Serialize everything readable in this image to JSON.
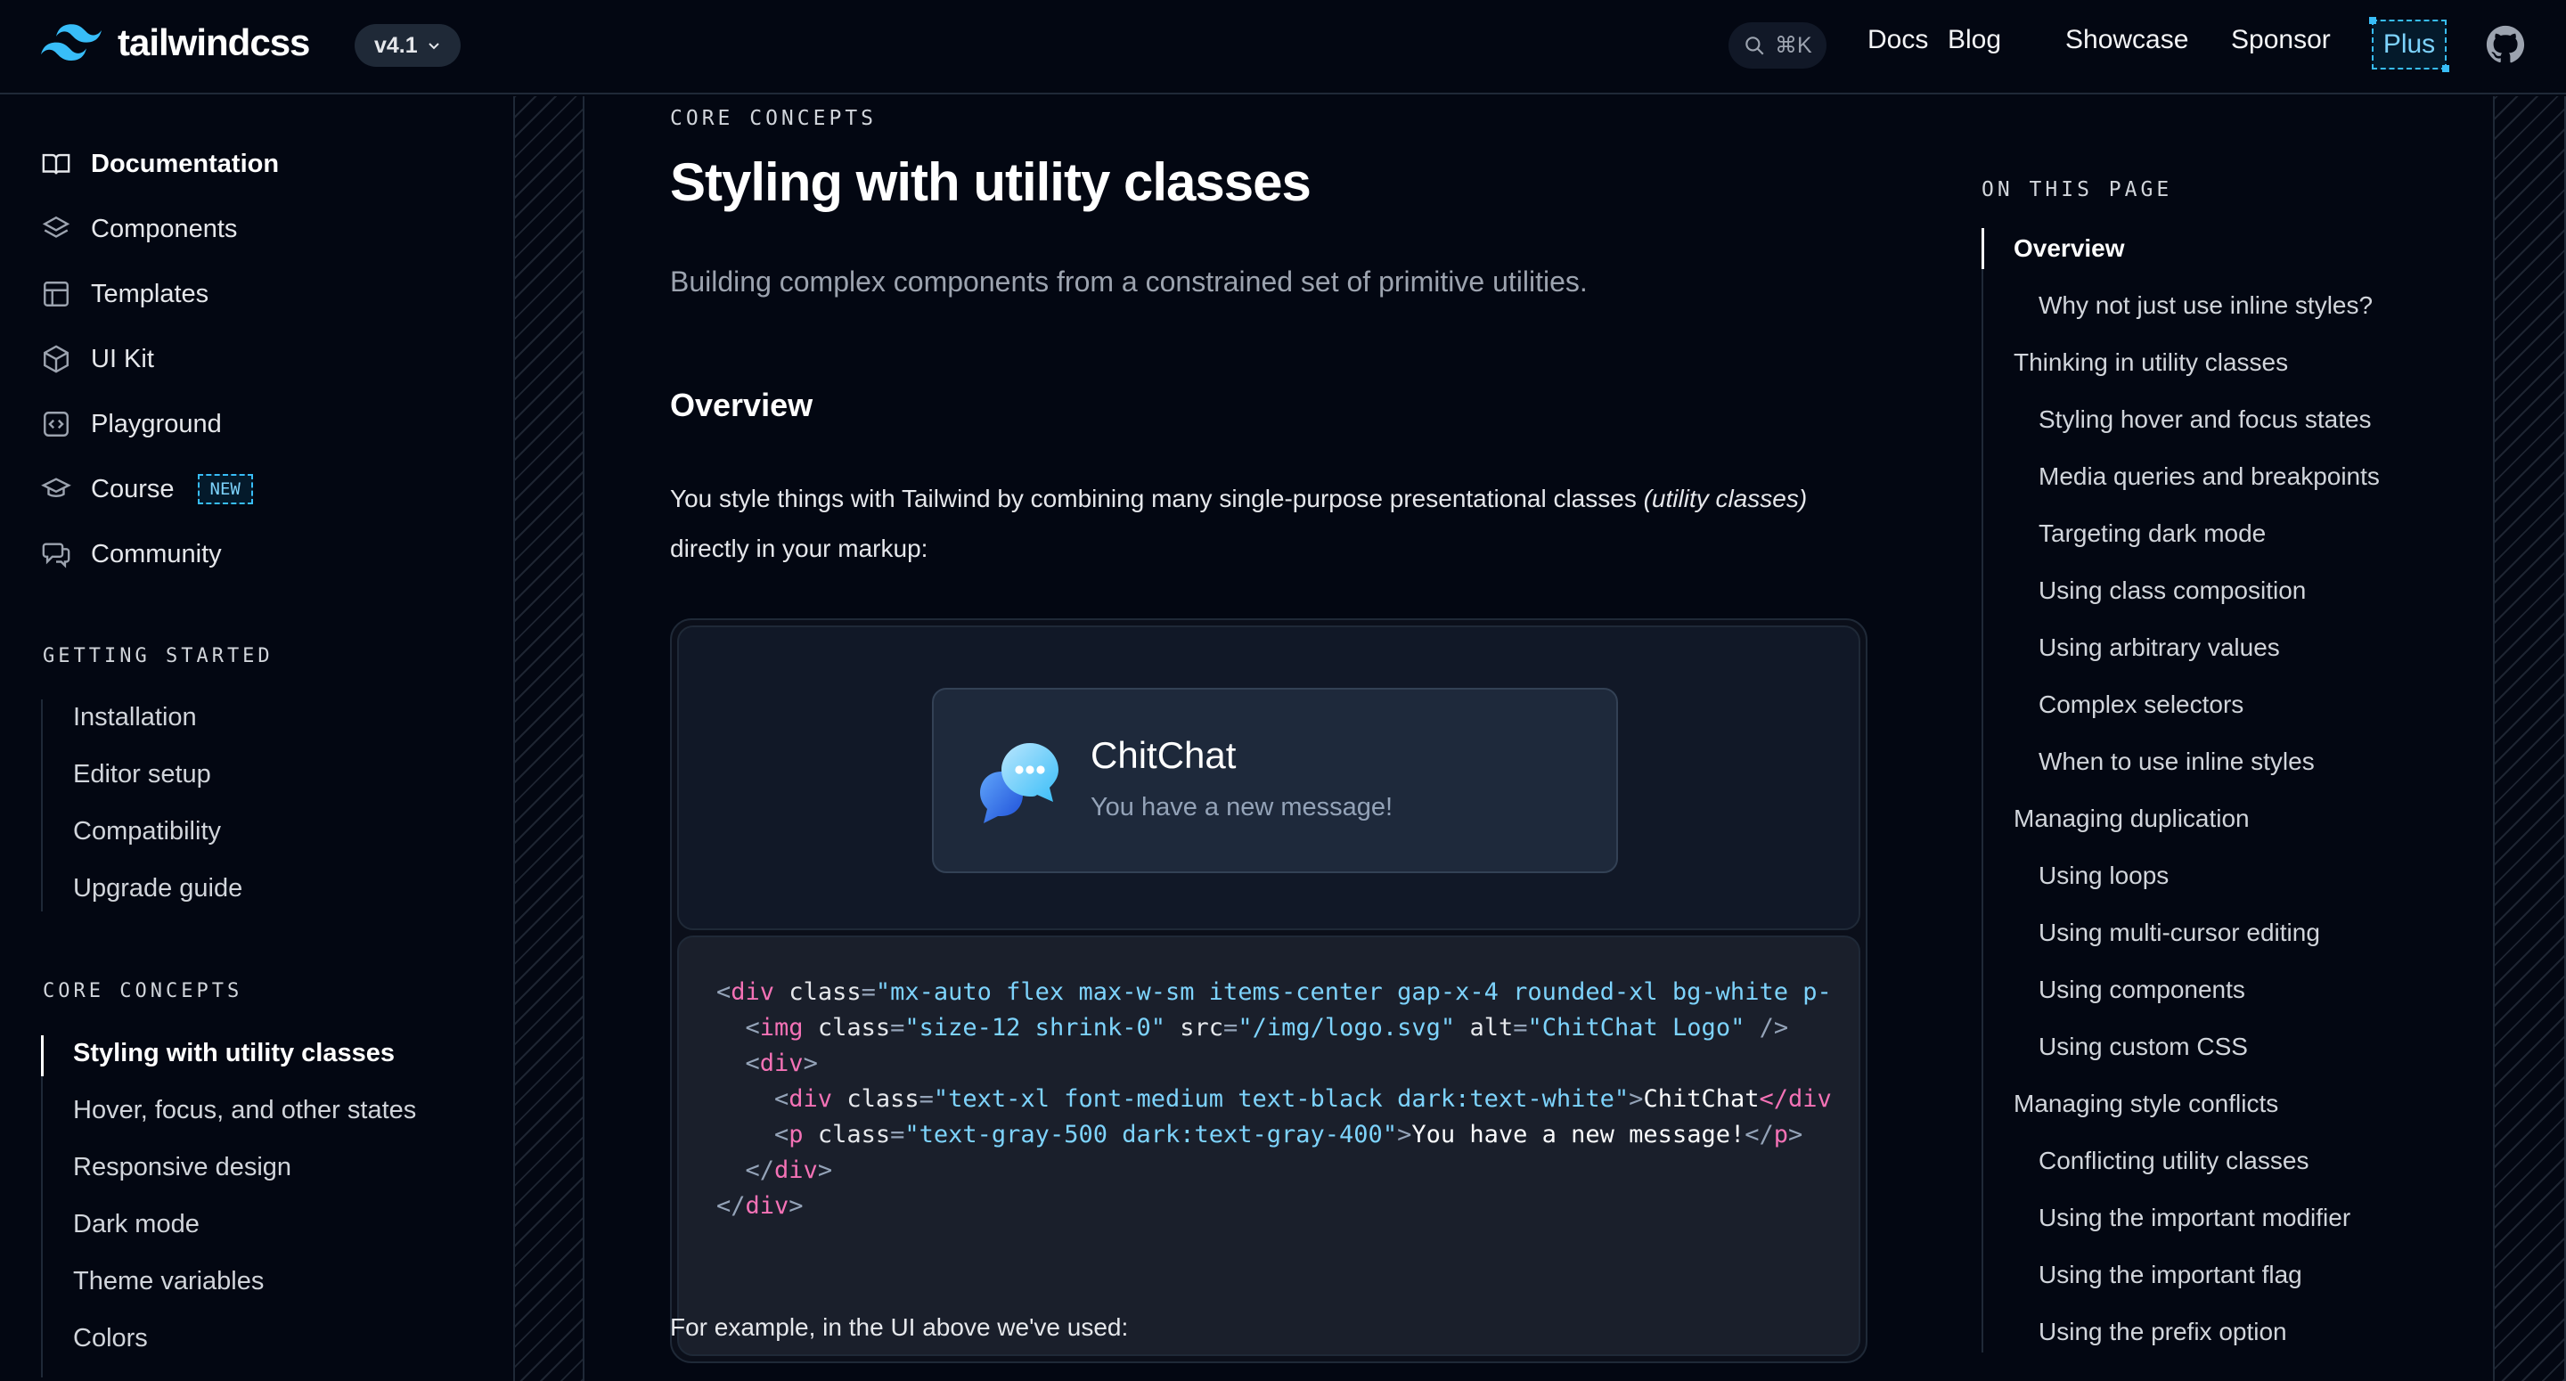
{
  "header": {
    "brand": "tailwindcss",
    "version": "v4.1",
    "search_shortcut": "⌘K",
    "nav": [
      "Docs",
      "Blog",
      "Showcase",
      "Sponsor"
    ],
    "plus": "Plus"
  },
  "sidebar": {
    "primary": [
      {
        "label": "Documentation",
        "icon": "book-icon",
        "active": true
      },
      {
        "label": "Components",
        "icon": "layers-icon"
      },
      {
        "label": "Templates",
        "icon": "template-icon"
      },
      {
        "label": "UI Kit",
        "icon": "box-icon"
      },
      {
        "label": "Playground",
        "icon": "code-icon"
      },
      {
        "label": "Course",
        "icon": "graduation-cap-icon",
        "badge": "NEW"
      },
      {
        "label": "Community",
        "icon": "chat-bubbles-icon"
      }
    ],
    "getting_started": {
      "title": "GETTING STARTED",
      "items": [
        "Installation",
        "Editor setup",
        "Compatibility",
        "Upgrade guide"
      ]
    },
    "core_concepts": {
      "title": "CORE CONCEPTS",
      "items": [
        "Styling with utility classes",
        "Hover, focus, and other states",
        "Responsive design",
        "Dark mode",
        "Theme variables",
        "Colors"
      ]
    }
  },
  "main": {
    "eyebrow": "CORE CONCEPTS",
    "title": "Styling with utility classes",
    "lead": "Building complex components from a constrained set of primitive utilities.",
    "section_title": "Overview",
    "para_before": "You style things with Tailwind by combining many single-purpose presentational classes ",
    "para_em": "(utility classes)",
    "para_after": " directly in your markup:",
    "demo": {
      "title": "ChitChat",
      "subtitle": "You have a new message!"
    },
    "code": [
      {
        "indent": "",
        "tag": "div",
        "attrs": [
          [
            "class",
            "mx-auto flex max-w-sm items-center gap-x-4 rounded-xl bg-white p-"
          ]
        ],
        "open_only": true,
        "truncated": true
      },
      {
        "indent": "  ",
        "tag": "img",
        "attrs": [
          [
            "class",
            "size-12 shrink-0"
          ],
          [
            "src",
            "/img/logo.svg"
          ],
          [
            "alt",
            "ChitChat Logo"
          ]
        ],
        "self_close": true
      },
      {
        "indent": "  ",
        "tag": "div",
        "attrs": [],
        "open_only": true
      },
      {
        "indent": "    ",
        "tag": "div",
        "attrs": [
          [
            "class",
            "text-xl font-medium text-black dark:text-white"
          ]
        ],
        "text": "ChitChat",
        "close_partial": "</div"
      },
      {
        "indent": "    ",
        "tag": "p",
        "attrs": [
          [
            "class",
            "text-gray-500 dark:text-gray-400"
          ]
        ],
        "text": "You have a new message!",
        "close": true
      },
      {
        "indent": "  ",
        "close_tag": "div"
      },
      {
        "indent": "",
        "close_tag": "div"
      }
    ],
    "footer_para": "For example, in the UI above we've used:"
  },
  "toc": {
    "title": "ON THIS PAGE",
    "items": [
      {
        "label": "Overview",
        "level": 1,
        "active": true
      },
      {
        "label": "Why not just use inline styles?",
        "level": 2
      },
      {
        "label": "Thinking in utility classes",
        "level": 1
      },
      {
        "label": "Styling hover and focus states",
        "level": 2
      },
      {
        "label": "Media queries and breakpoints",
        "level": 2
      },
      {
        "label": "Targeting dark mode",
        "level": 2
      },
      {
        "label": "Using class composition",
        "level": 2
      },
      {
        "label": "Using arbitrary values",
        "level": 2
      },
      {
        "label": "Complex selectors",
        "level": 2
      },
      {
        "label": "When to use inline styles",
        "level": 2
      },
      {
        "label": "Managing duplication",
        "level": 1
      },
      {
        "label": "Using loops",
        "level": 2
      },
      {
        "label": "Using multi-cursor editing",
        "level": 2
      },
      {
        "label": "Using components",
        "level": 2
      },
      {
        "label": "Using custom CSS",
        "level": 2
      },
      {
        "label": "Managing style conflicts",
        "level": 1
      },
      {
        "label": "Conflicting utility classes",
        "level": 2
      },
      {
        "label": "Using the important modifier",
        "level": 2
      },
      {
        "label": "Using the important flag",
        "level": 2
      },
      {
        "label": "Using the prefix option",
        "level": 2
      }
    ]
  },
  "colors": {
    "background": "#030712",
    "accent": "#38bdf8",
    "code_tag": "#f472b6",
    "code_string": "#7dd3fc"
  }
}
